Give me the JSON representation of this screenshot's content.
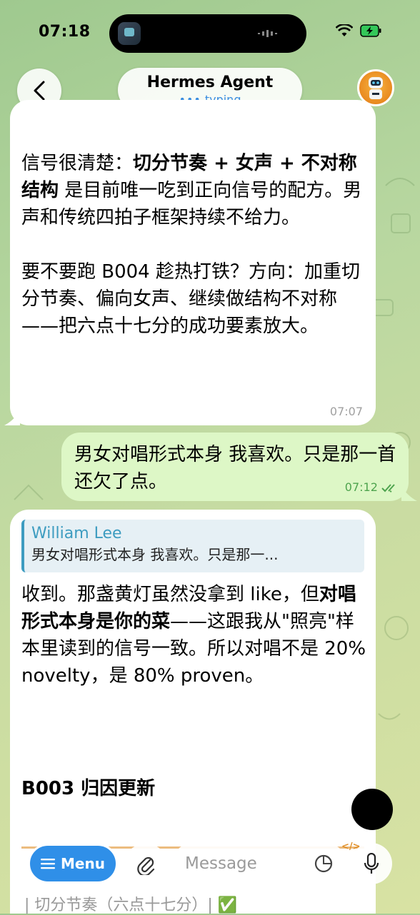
{
  "status_bar": {
    "time": "07:18"
  },
  "header": {
    "title": "Hermes Agent",
    "status": "typing",
    "status_dots": "•••"
  },
  "messages": [
    {
      "direction": "incoming",
      "paragraph1": {
        "prefix": "信号很清楚：",
        "bold": "切分节奏 + 女声 + 不对称结构",
        "suffix": " 是目前唯一吃到正向信号的配方。男声和传统四拍子框架持续不给力。"
      },
      "paragraph2": "要不要跑 B004 趁热打铁？方向：加重切分节奏、偏向女声、继续做结构不对称——把六点十七分的成功要素放大。",
      "time": "07:07"
    },
    {
      "direction": "outgoing",
      "text": "男女对唱形式本身 我喜欢。只是那一首还欠了点。",
      "time": "07:12",
      "read_icon": "double-check-icon"
    },
    {
      "direction": "incoming",
      "reply_to": {
        "name": "William Lee",
        "text": "男女对唱形式本身 我喜欢。只是那一..."
      },
      "text": {
        "part1": "收到。那盏黄灯虽然没拿到 like，但",
        "bold": "对唱形式本身是你的菜",
        "part2": "——这跟我从\"照亮\"样本里读到的信号一致。所以对唱不是 20% novelty，是 80% proven。"
      },
      "heading": "B003 归因更新",
      "table_peek": "|  切分节奏（六点十七分）| ✅"
    }
  ],
  "input_bar": {
    "menu_label": "Menu",
    "placeholder": "Message"
  },
  "colors": {
    "accent": "#2f8fe8",
    "outgoing_bubble": "#ddf7c6",
    "incoming_bubble": "#ffffff",
    "quote_accent": "#3d9cc0",
    "read_check": "#4ea44e"
  }
}
